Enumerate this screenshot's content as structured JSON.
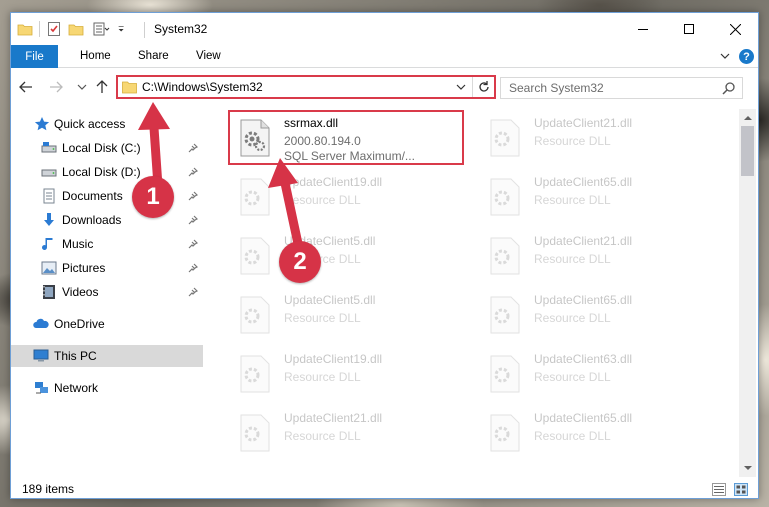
{
  "window": {
    "title": "System32"
  },
  "ribbon": {
    "file_tab": "File",
    "tabs": [
      "Home",
      "Share",
      "View"
    ]
  },
  "navbar": {
    "address": "C:\\Windows\\System32",
    "search_placeholder": "Search System32"
  },
  "sidebar": {
    "items": [
      {
        "label": "Quick access",
        "icon": "star-icon"
      },
      {
        "label": "Local Disk (C:)",
        "icon": "drive-icon",
        "pinned": true
      },
      {
        "label": "Local Disk (D:)",
        "icon": "drive-icon",
        "pinned": true
      },
      {
        "label": "Documents",
        "icon": "documents-icon",
        "pinned": true
      },
      {
        "label": "Downloads",
        "icon": "downloads-icon",
        "pinned": true
      },
      {
        "label": "Music",
        "icon": "music-icon",
        "pinned": true
      },
      {
        "label": "Pictures",
        "icon": "pictures-icon",
        "pinned": true
      },
      {
        "label": "Videos",
        "icon": "videos-icon",
        "pinned": true
      },
      {
        "label": "OneDrive",
        "icon": "cloud-icon"
      },
      {
        "label": "This PC",
        "icon": "computer-icon",
        "selected": true
      },
      {
        "label": "Network",
        "icon": "network-icon"
      }
    ]
  },
  "files": {
    "highlighted": {
      "name": "ssrmax.dll",
      "version": "2000.80.194.0",
      "description": "SQL Server Maximum/..."
    },
    "faded": [
      {
        "name": "UpdateClient21.dll",
        "type": "Resource DLL"
      },
      {
        "name": "UpdateClient19.dll",
        "type": "Resource DLL"
      },
      {
        "name": "UpdateClient65.dll",
        "type": "Resource DLL"
      },
      {
        "name": "UpdateClient5.dll",
        "type": "Resource DLL"
      },
      {
        "name": "UpdateClient21.dll",
        "type": "Resource DLL"
      },
      {
        "name": "UpdateClient5.dll",
        "type": "Resource DLL"
      },
      {
        "name": "UpdateClient65.dll",
        "type": "Resource DLL"
      },
      {
        "name": "UpdateClient19.dll",
        "type": "Resource DLL"
      },
      {
        "name": "UpdateClient63.dll",
        "type": "Resource DLL"
      },
      {
        "name": "UpdateClient21.dll",
        "type": "Resource DLL"
      },
      {
        "name": "UpdateClient65.dll",
        "type": "Resource DLL"
      }
    ]
  },
  "status": {
    "item_count": "189 items"
  },
  "annotations": {
    "badge_1": "1",
    "badge_2": "2",
    "color": "#d63347"
  }
}
